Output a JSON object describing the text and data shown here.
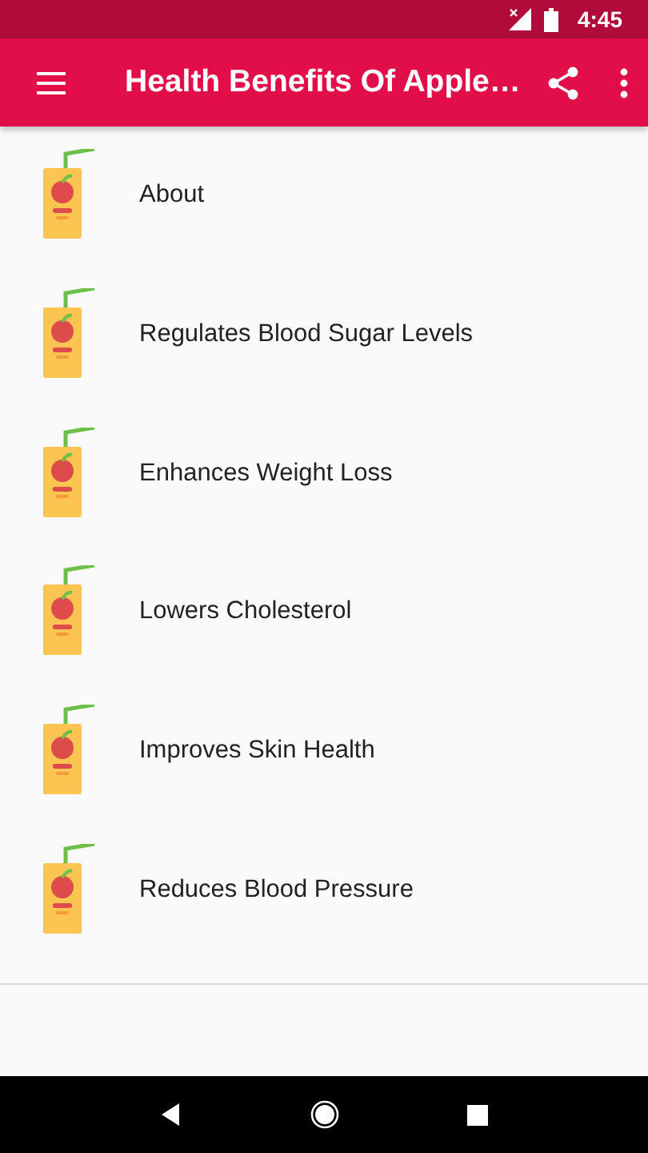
{
  "status_bar": {
    "time": "4:45"
  },
  "app_bar": {
    "title": "Health Benefits Of Apple…"
  },
  "items": [
    {
      "label": "About"
    },
    {
      "label": "Regulates Blood Sugar Levels"
    },
    {
      "label": "Enhances Weight Loss"
    },
    {
      "label": "Lowers Cholesterol"
    },
    {
      "label": "Improves Skin Health"
    },
    {
      "label": "Reduces Blood Pressure"
    }
  ]
}
